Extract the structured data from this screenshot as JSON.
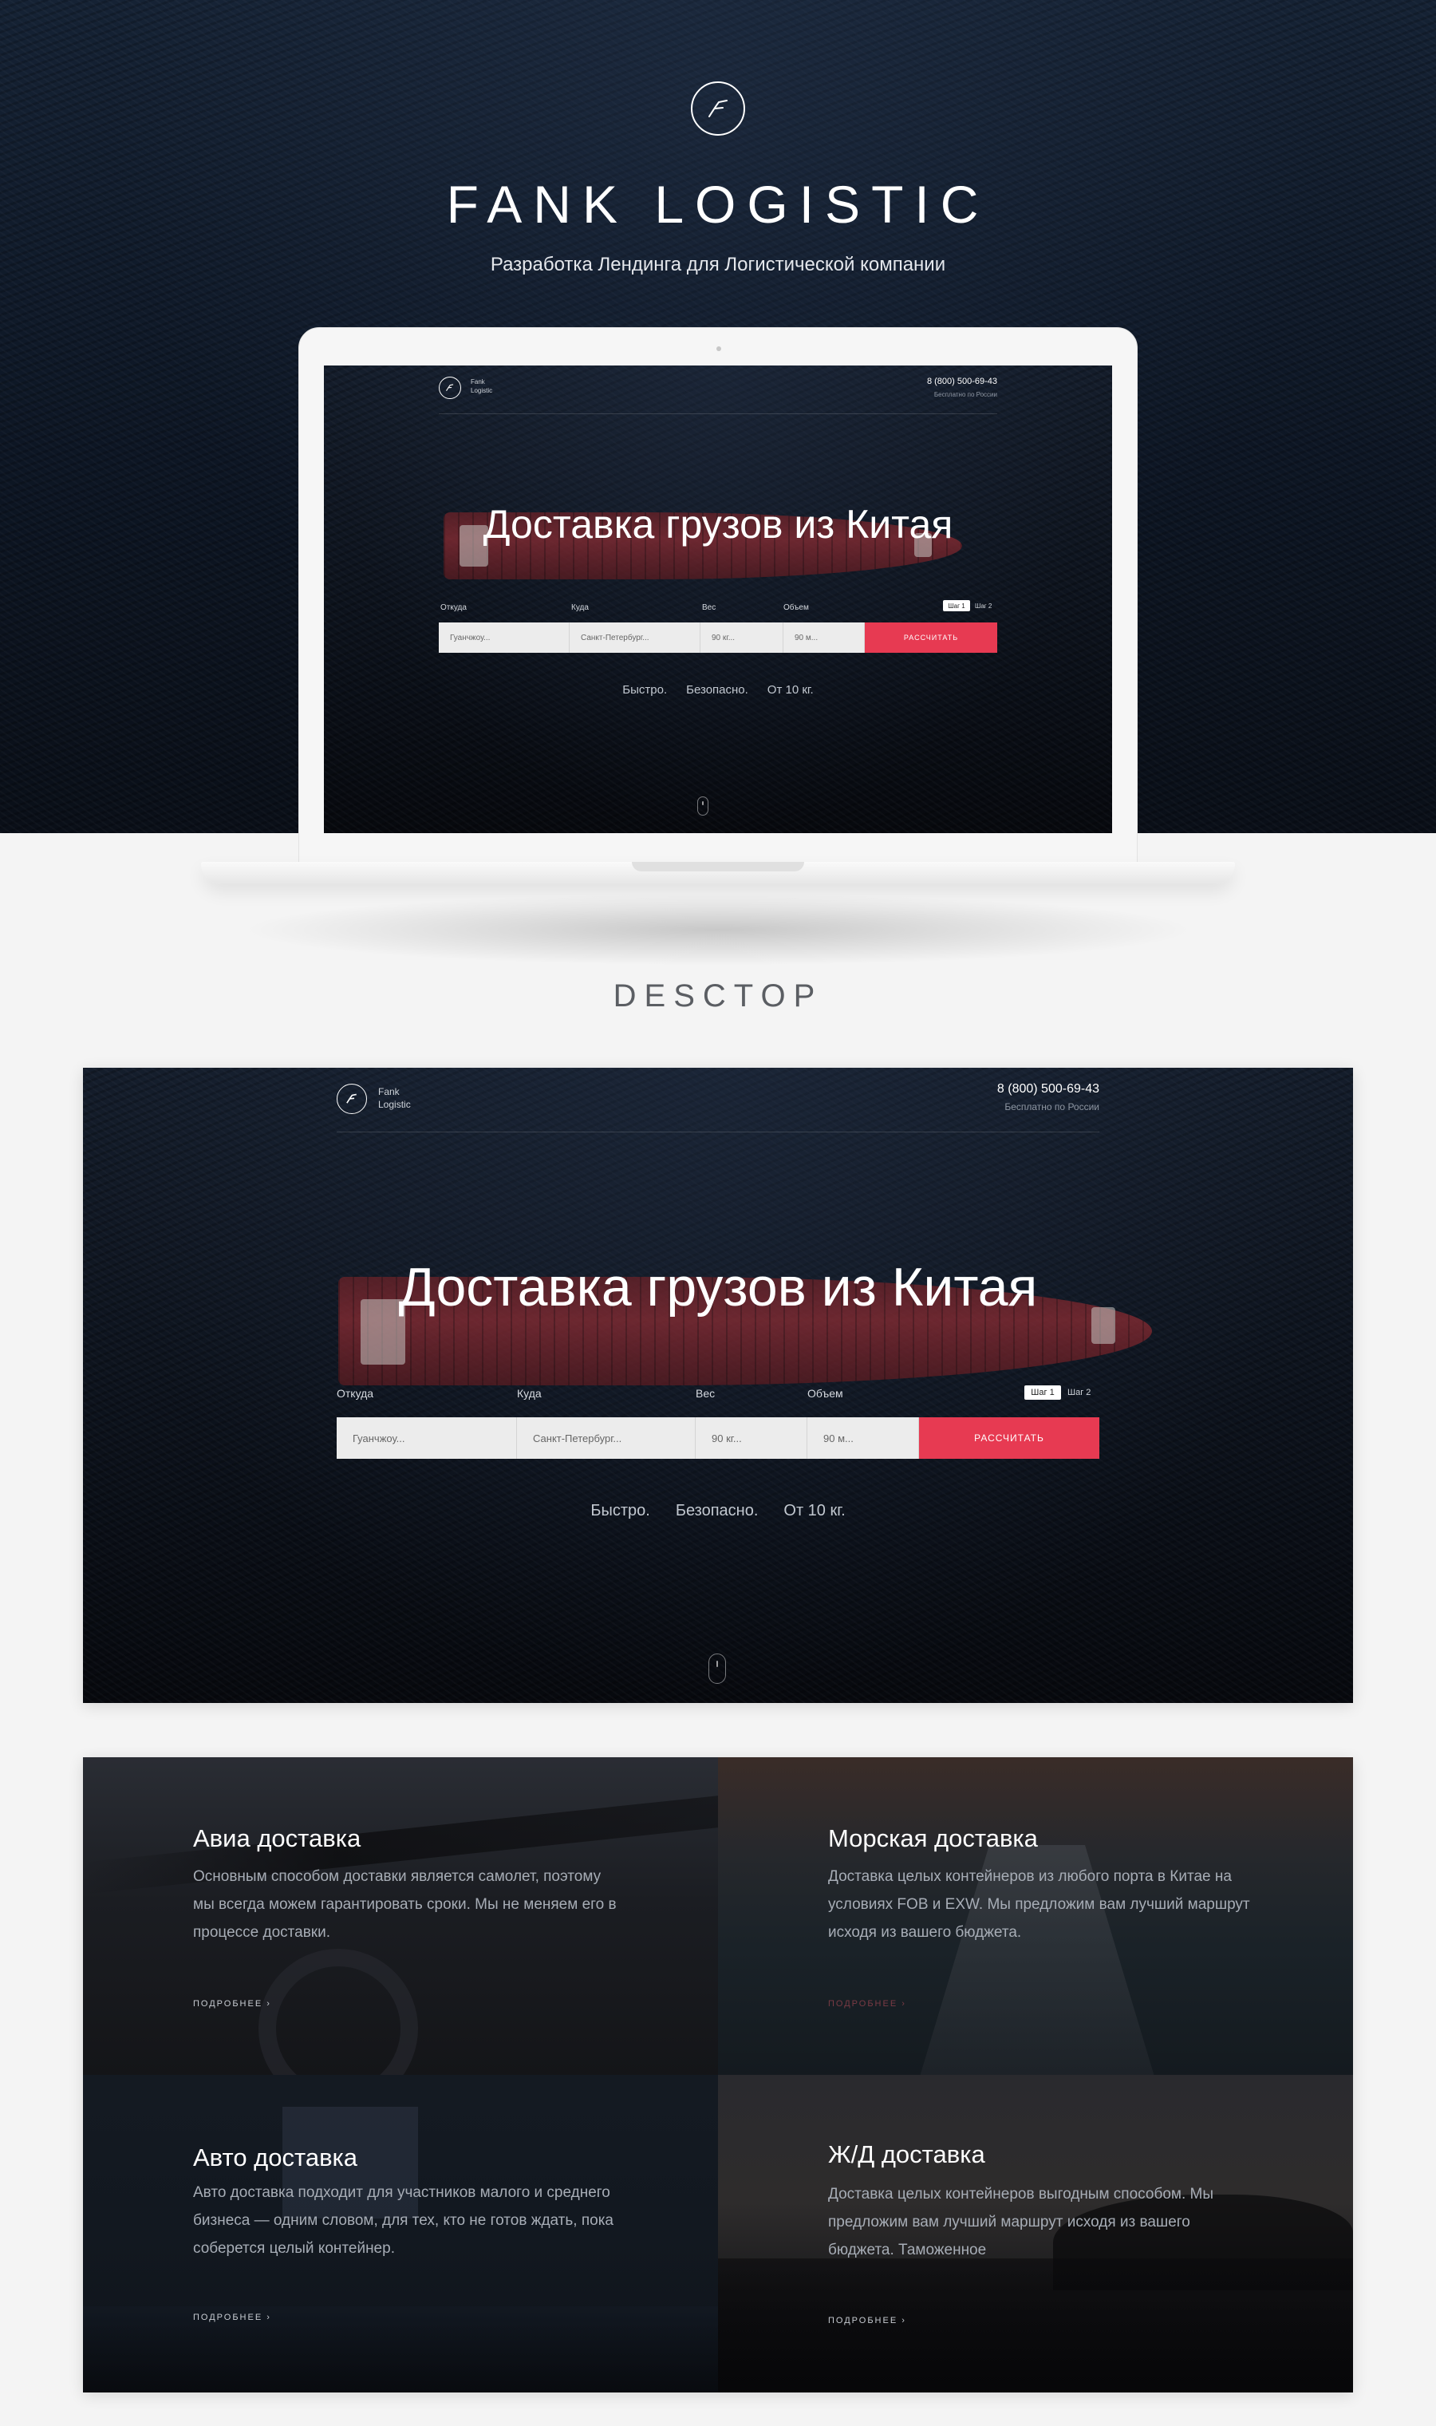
{
  "brand": {
    "title": "FANK LOGISTIC",
    "subtitle": "Разработка Лендинга для Логистической компании"
  },
  "section_label": "DESCTOP",
  "landing": {
    "brand_line1": "Fank",
    "brand_line2": "Logistic",
    "phone": "8 (800) 500-69-43",
    "phone_note": "Бесплатно по России",
    "headline": "Доставка грузов из Китая",
    "labels": {
      "from": "Откуда",
      "to": "Куда",
      "weight": "Вес",
      "volume": "Объем"
    },
    "steps": {
      "step1": "Шаг 1",
      "step2": "Шаг 2"
    },
    "fields": {
      "from": "Гуанчжоу...",
      "to": "Санкт-Петербург...",
      "weight": "90 кг...",
      "volume": "90 м..."
    },
    "submit": "РАССЧИТАТЬ",
    "tagline": [
      "Быстро.",
      "Безопасно.",
      "От 10 кг."
    ]
  },
  "services": [
    {
      "title": "Авиа доставка",
      "text": "Основным способом доставки является самолет, поэтому мы всегда можем гарантировать сроки. Мы не меняем его в процессе доставки.",
      "link": "ПОДРОБНЕЕ ›"
    },
    {
      "title": "Морская доставка",
      "text": "Доставка целых контейнеров из любого порта в Китае на условиях FOB и EXW. Мы предложим вам лучший маршрут исходя из вашего бюджета.",
      "link": "ПОДРОБНЕЕ ›"
    },
    {
      "title": "Авто доставка",
      "text": "Авто доставка подходит для участников малого и среднего бизнеса — одним словом, для тех, кто не готов ждать, пока соберется целый контейнер.",
      "link": "ПОДРОБНЕЕ ›"
    },
    {
      "title": "Ж/Д доставка",
      "text": "Доставка целых контейнеров выгодным способом. Мы предложим вам лучший маршрут исходя из вашего бюджета. Таможенное",
      "link": "ПОДРОБНЕЕ ›"
    }
  ],
  "colors": {
    "accent": "#e73a52",
    "dark_bg": "#0b1019",
    "page_bg": "#f4f4f4"
  },
  "icons": {
    "logo": "f-monogram-icon",
    "scroll": "mouse-scroll-icon"
  }
}
